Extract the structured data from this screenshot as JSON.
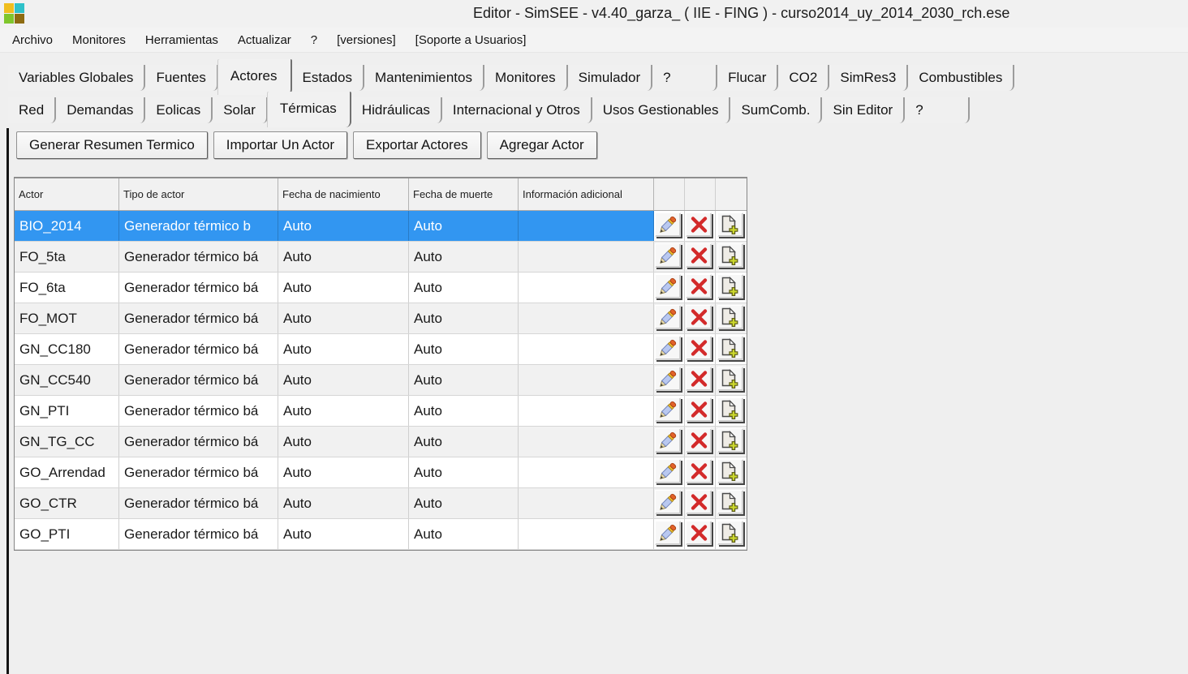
{
  "window": {
    "title": "Editor - SimSEE - v4.40_garza_ ( IIE - FING ) - curso2014_uy_2014_2030_rch.ese",
    "logo_colors": [
      "#f0be1e",
      "#2fc1c9",
      "#7fc62c",
      "#8e6c12"
    ]
  },
  "menu": {
    "items": [
      "Archivo",
      "Monitores",
      "Herramientas",
      "Actualizar",
      "?",
      "[versiones]",
      "[Soporte a Usuarios]"
    ]
  },
  "tabs": {
    "primary": [
      {
        "label": "Variables Globales",
        "active": false
      },
      {
        "label": "Fuentes",
        "active": false
      },
      {
        "label": "Actores",
        "active": true
      },
      {
        "label": "Estados",
        "active": false
      },
      {
        "label": "Mantenimientos",
        "active": false
      },
      {
        "label": "Monitores",
        "active": false
      },
      {
        "label": "Simulador",
        "active": false
      },
      {
        "label": "?",
        "active": false
      },
      {
        "label": "Flucar",
        "active": false
      },
      {
        "label": "CO2",
        "active": false
      },
      {
        "label": "SimRes3",
        "active": false
      },
      {
        "label": "Combustibles",
        "active": false
      }
    ],
    "secondary": [
      {
        "label": "Red",
        "active": false
      },
      {
        "label": "Demandas",
        "active": false
      },
      {
        "label": "Eolicas",
        "active": false
      },
      {
        "label": "Solar",
        "active": false
      },
      {
        "label": "Térmicas",
        "active": true
      },
      {
        "label": "Hidráulicas",
        "active": false
      },
      {
        "label": "Internacional y Otros",
        "active": false
      },
      {
        "label": "Usos Gestionables",
        "active": false
      },
      {
        "label": "SumComb.",
        "active": false
      },
      {
        "label": "Sin Editor",
        "active": false
      },
      {
        "label": "?",
        "active": false
      }
    ]
  },
  "toolbar": {
    "buttons": [
      "Generar Resumen Termico",
      "Importar Un Actor",
      "Exportar Actores",
      "Agregar Actor"
    ]
  },
  "table": {
    "columns": [
      "Actor",
      "Tipo de actor",
      "Fecha de nacimiento",
      "Fecha de muerte",
      "Información adicional"
    ],
    "row_actions": [
      "edit",
      "delete",
      "duplicate"
    ],
    "rows": [
      {
        "actor": "BIO_2014",
        "tipo": "Generador térmico b",
        "nacimiento": "Auto",
        "muerte": "Auto",
        "info": "",
        "selected": true
      },
      {
        "actor": "FO_5ta",
        "tipo": "Generador térmico bá",
        "nacimiento": "Auto",
        "muerte": "Auto",
        "info": "",
        "selected": false
      },
      {
        "actor": "FO_6ta",
        "tipo": "Generador térmico bá",
        "nacimiento": "Auto",
        "muerte": "Auto",
        "info": "",
        "selected": false
      },
      {
        "actor": "FO_MOT",
        "tipo": "Generador térmico bá",
        "nacimiento": "Auto",
        "muerte": "Auto",
        "info": "",
        "selected": false
      },
      {
        "actor": "GN_CC180",
        "tipo": "Generador térmico bá",
        "nacimiento": "Auto",
        "muerte": "Auto",
        "info": "",
        "selected": false
      },
      {
        "actor": "GN_CC540",
        "tipo": "Generador térmico bá",
        "nacimiento": "Auto",
        "muerte": "Auto",
        "info": "",
        "selected": false
      },
      {
        "actor": "GN_PTI",
        "tipo": "Generador térmico bá",
        "nacimiento": "Auto",
        "muerte": "Auto",
        "info": "",
        "selected": false
      },
      {
        "actor": "GN_TG_CC",
        "tipo": "Generador térmico bá",
        "nacimiento": "Auto",
        "muerte": "Auto",
        "info": "",
        "selected": false
      },
      {
        "actor": "GO_Arrendad",
        "tipo": "Generador térmico bá",
        "nacimiento": "Auto",
        "muerte": "Auto",
        "info": "",
        "selected": false
      },
      {
        "actor": "GO_CTR",
        "tipo": "Generador térmico bá",
        "nacimiento": "Auto",
        "muerte": "Auto",
        "info": "",
        "selected": false
      },
      {
        "actor": "GO_PTI",
        "tipo": "Generador térmico bá",
        "nacimiento": "Auto",
        "muerte": "Auto",
        "info": "",
        "selected": false
      }
    ]
  },
  "colors": {
    "selection": "#3296f1",
    "delete_x": "#d32a2a",
    "pencil_body": "#b9c8f0",
    "pencil_tip": "#e2622a",
    "pencil_band": "#f2c12e",
    "plus_green": "#cdd92e"
  }
}
